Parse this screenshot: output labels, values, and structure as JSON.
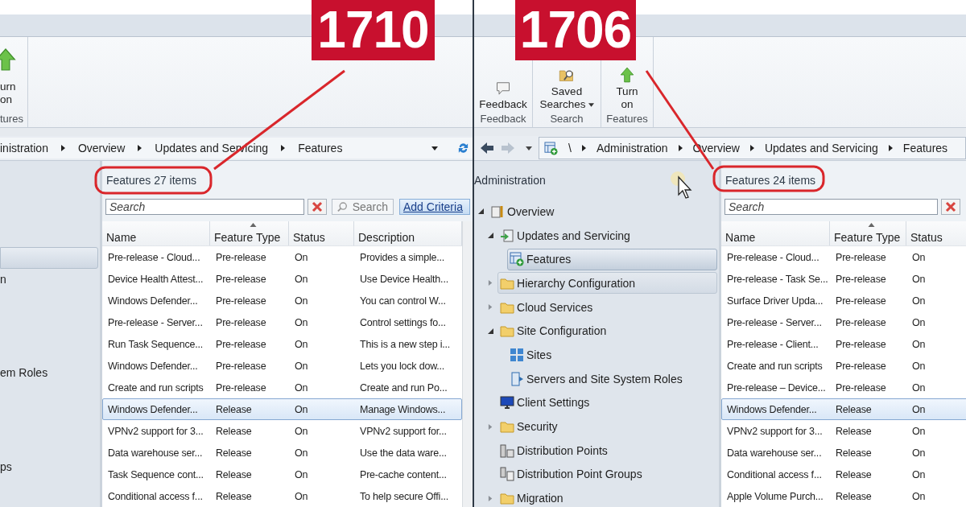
{
  "left_pane": {
    "version_label": "1710",
    "ribbon": [
      {
        "label": "tures",
        "buttons": [
          {
            "kind": "turn_on",
            "lines": [
              "urn",
              "on"
            ],
            "dropdown": false
          }
        ]
      }
    ],
    "breadcrumb": [
      "inistration",
      "Overview",
      "Updates and Servicing",
      "Features"
    ],
    "nav": [
      {
        "selected": true
      },
      {
        "label": "n",
        "selected": false
      },
      {
        "label": "em Roles",
        "selected": false
      },
      {
        "label": "ps",
        "selected": false
      }
    ],
    "content": {
      "title": "Features 27 items",
      "search": {
        "placeholder": "Search"
      },
      "search_button": "Search",
      "add_criteria": "Add Criteria",
      "columns": [
        {
          "label": "Name",
          "sorted": false
        },
        {
          "label": "Feature Type",
          "sorted": true
        },
        {
          "label": "Status",
          "sorted": false
        },
        {
          "label": "Description",
          "sorted": false
        }
      ],
      "rows": [
        {
          "cells": [
            "Pre-release - Cloud...",
            "Pre-release",
            "On",
            "Provides a simple..."
          ],
          "selected": false
        },
        {
          "cells": [
            "Device Health Attest...",
            "Pre-release",
            "On",
            "Use Device Health..."
          ],
          "selected": false
        },
        {
          "cells": [
            "Windows Defender...",
            "Pre-release",
            "On",
            "You can control W..."
          ],
          "selected": false
        },
        {
          "cells": [
            "Pre-release - Server...",
            "Pre-release",
            "On",
            "Control settings fo..."
          ],
          "selected": false
        },
        {
          "cells": [
            "Run Task Sequence...",
            "Pre-release",
            "On",
            "This is a new step i..."
          ],
          "selected": false
        },
        {
          "cells": [
            "Windows Defender...",
            "Pre-release",
            "On",
            "Lets you lock dow..."
          ],
          "selected": false
        },
        {
          "cells": [
            "Create and run scripts",
            "Pre-release",
            "On",
            "Create and run Po..."
          ],
          "selected": false
        },
        {
          "cells": [
            "Windows Defender...",
            "Release",
            "On",
            "Manage Windows..."
          ],
          "selected": true
        },
        {
          "cells": [
            "VPNv2 support for 3...",
            "Release",
            "On",
            "VPNv2 support for..."
          ],
          "selected": false
        },
        {
          "cells": [
            "Data warehouse ser...",
            "Release",
            "On",
            "Use the data ware..."
          ],
          "selected": false
        },
        {
          "cells": [
            "Task Sequence cont...",
            "Release",
            "On",
            "Pre-cache content..."
          ],
          "selected": false
        },
        {
          "cells": [
            "Conditional access f...",
            "Release",
            "On",
            "To help secure Offi..."
          ],
          "selected": false
        }
      ]
    }
  },
  "right_pane": {
    "version_label": "1706",
    "ribbon": [
      {
        "label": "Feedback",
        "buttons": [
          {
            "kind": "feedback",
            "lines": [
              "Feedback"
            ],
            "dropdown": false
          }
        ]
      },
      {
        "label": "Search",
        "buttons": [
          {
            "kind": "saved_searches",
            "lines": [
              "Saved",
              "Searches"
            ],
            "dropdown": true
          }
        ]
      },
      {
        "label": "Features",
        "buttons": [
          {
            "kind": "turn_on",
            "lines": [
              "Turn",
              "on"
            ],
            "dropdown": false
          }
        ]
      }
    ],
    "breadcrumb": [
      "\\",
      "Administration",
      "Overview",
      "Updates and Servicing",
      "Features"
    ],
    "nav": {
      "title": "Administration",
      "tree": [
        {
          "label": "Overview",
          "kind": "overview",
          "expanded": true,
          "selected": false,
          "hovered": false,
          "children": [
            {
              "label": "Updates and Servicing",
              "kind": "updates",
              "expanded": true,
              "selected": false,
              "hovered": false,
              "children": [
                {
                  "label": "Features",
                  "kind": "features",
                  "selected": true,
                  "hovered": false
                }
              ]
            },
            {
              "label": "Hierarchy Configuration",
              "kind": "folder",
              "expanded": false,
              "selected": false,
              "hovered": true
            },
            {
              "label": "Cloud Services",
              "kind": "folder",
              "expanded": false,
              "selected": false,
              "hovered": false
            },
            {
              "label": "Site Configuration",
              "kind": "folder",
              "expanded": true,
              "selected": false,
              "hovered": false,
              "children": [
                {
                  "label": "Sites",
                  "kind": "sites",
                  "selected": false,
                  "hovered": false
                },
                {
                  "label": "Servers and Site System Roles",
                  "kind": "servers",
                  "selected": false,
                  "hovered": false
                }
              ]
            },
            {
              "label": "Client Settings",
              "kind": "client",
              "selected": false,
              "hovered": false
            },
            {
              "label": "Security",
              "kind": "folder",
              "expanded": false,
              "selected": false,
              "hovered": false
            },
            {
              "label": "Distribution Points",
              "kind": "dp",
              "selected": false,
              "hovered": false
            },
            {
              "label": "Distribution Point Groups",
              "kind": "dpgroup",
              "selected": false,
              "hovered": false
            },
            {
              "label": "Migration",
              "kind": "folder",
              "expanded": false,
              "selected": false,
              "hovered": false
            }
          ]
        }
      ]
    },
    "content": {
      "title": "Features 24 items",
      "search": {
        "placeholder": "Search"
      },
      "columns": [
        {
          "label": "Name",
          "sorted": false
        },
        {
          "label": "Feature Type",
          "sorted": true
        },
        {
          "label": "Status",
          "sorted": false
        }
      ],
      "rows": [
        {
          "cells": [
            "Pre-release - Cloud...",
            "Pre-release",
            "On"
          ],
          "selected": false
        },
        {
          "cells": [
            "Pre-release - Task Se...",
            "Pre-release",
            "On"
          ],
          "selected": false
        },
        {
          "cells": [
            "Surface Driver Upda...",
            "Pre-release",
            "On"
          ],
          "selected": false
        },
        {
          "cells": [
            "Pre-release - Server...",
            "Pre-release",
            "On"
          ],
          "selected": false
        },
        {
          "cells": [
            "Pre-release - Client...",
            "Pre-release",
            "On"
          ],
          "selected": false
        },
        {
          "cells": [
            "Create and run scripts",
            "Pre-release",
            "On"
          ],
          "selected": false
        },
        {
          "cells": [
            "Pre-release – Device...",
            "Pre-release",
            "On"
          ],
          "selected": false
        },
        {
          "cells": [
            "Windows Defender...",
            "Release",
            "On"
          ],
          "selected": true
        },
        {
          "cells": [
            "VPNv2 support for 3...",
            "Release",
            "On"
          ],
          "selected": false
        },
        {
          "cells": [
            "Data warehouse ser...",
            "Release",
            "On"
          ],
          "selected": false
        },
        {
          "cells": [
            "Conditional access f...",
            "Release",
            "On"
          ],
          "selected": false
        },
        {
          "cells": [
            "Apple Volume Purch...",
            "Release",
            "On"
          ],
          "selected": false
        }
      ]
    }
  }
}
